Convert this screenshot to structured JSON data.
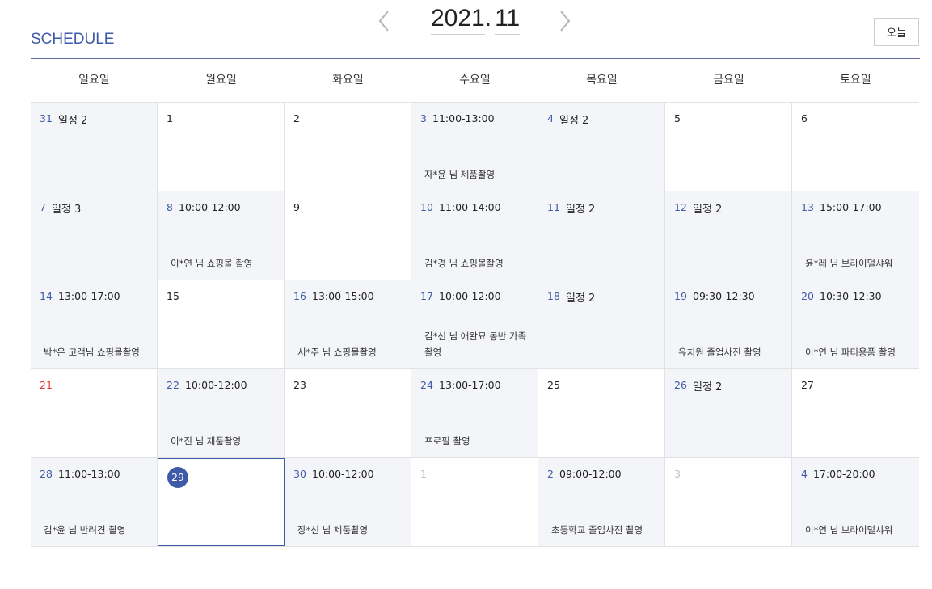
{
  "header": {
    "title": "SCHEDULE",
    "year": "2021",
    "dot": ".",
    "month": "11",
    "today_label": "오늘"
  },
  "weekdays": [
    "일요일",
    "월요일",
    "화요일",
    "수요일",
    "목요일",
    "금요일",
    "토요일"
  ],
  "weeks": [
    [
      {
        "day": "31",
        "style": "blue",
        "count": "일정 2"
      },
      {
        "day": "1"
      },
      {
        "day": "2"
      },
      {
        "day": "3",
        "style": "blue",
        "time": "11:00-13:00",
        "desc": "자*윤 님 제품촬영"
      },
      {
        "day": "4",
        "style": "blue",
        "count": "일정 2"
      },
      {
        "day": "5"
      },
      {
        "day": "6"
      }
    ],
    [
      {
        "day": "7",
        "style": "blue",
        "count": "일정 3"
      },
      {
        "day": "8",
        "style": "blue",
        "time": "10:00-12:00",
        "desc": "이*연 님 쇼핑몰 촬영"
      },
      {
        "day": "9"
      },
      {
        "day": "10",
        "style": "blue",
        "time": "11:00-14:00",
        "desc": "김*경 님 쇼핑몰촬영"
      },
      {
        "day": "11",
        "style": "blue",
        "count": "일정 2"
      },
      {
        "day": "12",
        "style": "blue",
        "count": "일정 2"
      },
      {
        "day": "13",
        "style": "blue",
        "time": "15:00-17:00",
        "desc": "윤*레 님 브라이덜샤워"
      }
    ],
    [
      {
        "day": "14",
        "style": "blue",
        "time": "13:00-17:00",
        "desc": "박*온 고객님 쇼핑몰촬영"
      },
      {
        "day": "15"
      },
      {
        "day": "16",
        "style": "blue",
        "time": "13:00-15:00",
        "desc": "서*주 님 쇼핑몰촬영"
      },
      {
        "day": "17",
        "style": "blue",
        "time": "10:00-12:00",
        "desc": "김*선 님 애완묘 동반 가족 촬영"
      },
      {
        "day": "18",
        "style": "blue",
        "count": "일정 2"
      },
      {
        "day": "19",
        "style": "blue",
        "time": "09:30-12:30",
        "desc": "유치원 졸업사진 촬영"
      },
      {
        "day": "20",
        "style": "blue",
        "time": "10:30-12:30",
        "desc": "이*연 님 파티용품 촬영"
      }
    ],
    [
      {
        "day": "21",
        "style": "red"
      },
      {
        "day": "22",
        "style": "blue",
        "time": "10:00-12:00",
        "desc": "이*진 님 제품촬영"
      },
      {
        "day": "23"
      },
      {
        "day": "24",
        "style": "blue",
        "time": "13:00-17:00",
        "desc": "프로필 촬영"
      },
      {
        "day": "25"
      },
      {
        "day": "26",
        "style": "blue",
        "count": "일정 2"
      },
      {
        "day": "27"
      }
    ],
    [
      {
        "day": "28",
        "style": "blue",
        "time": "11:00-13:00",
        "desc": "김*윤 님 반려견 촬영"
      },
      {
        "day": "29",
        "style": "today"
      },
      {
        "day": "30",
        "style": "blue",
        "time": "10:00-12:00",
        "desc": "장*선 님 제품촬영"
      },
      {
        "day": "1",
        "style": "gray"
      },
      {
        "day": "2",
        "style": "blue",
        "time": "09:00-12:00",
        "desc": "초등학교 졸업사진 촬영"
      },
      {
        "day": "3",
        "style": "gray"
      },
      {
        "day": "4",
        "style": "blue",
        "time": "17:00-20:00",
        "desc": "이*연 님 브라이덜샤워"
      }
    ]
  ],
  "icons": {
    "prev": "chevron-left-icon",
    "next": "chevron-right-icon"
  },
  "colors": {
    "accent": "#3f5ba8",
    "sunday": "#e23a3a",
    "event_bg": "#f4f5f9"
  }
}
